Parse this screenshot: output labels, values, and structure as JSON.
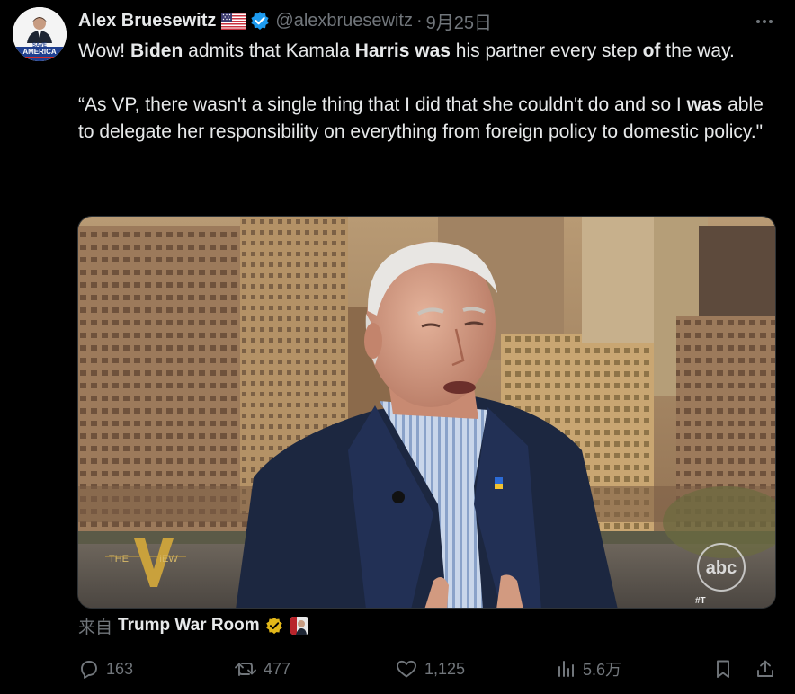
{
  "tweet": {
    "author_name": "Alex Bruesewitz",
    "handle": "@alexbruesewitz",
    "separator": "·",
    "time": "9月25日",
    "avatar_text_line1": "SAVE",
    "avatar_text_line2": "AMERICA",
    "para1": [
      {
        "text": "Wow! ",
        "bold": false
      },
      {
        "text": "Biden",
        "bold": true
      },
      {
        "text": " admits that Kamala ",
        "bold": false
      },
      {
        "text": "Harris was",
        "bold": true
      },
      {
        "text": " his partner every step ",
        "bold": false
      },
      {
        "text": "of",
        "bold": true
      },
      {
        "text": " the way.",
        "bold": false
      }
    ],
    "para2": [
      {
        "text": "“As VP, there wasn't a single thing that I did that she couldn't do and so I ",
        "bold": false
      },
      {
        "text": "was",
        "bold": true
      },
      {
        "text": " able to delegate her responsibility on everything from foreign policy to domestic policy.\"",
        "bold": false
      }
    ]
  },
  "media": {
    "show_logo_left": "THE",
    "show_logo_v": "V",
    "show_logo_right": "IEW",
    "network_logo": "abc",
    "corner_tag": "#T"
  },
  "source": {
    "from_label": "来自",
    "account": "Trump War Room"
  },
  "actions": {
    "replies": "163",
    "retweets": "477",
    "likes": "1,125",
    "views": "5.6万"
  },
  "colors": {
    "background": "#000000",
    "text_primary": "#e7e9ea",
    "text_secondary": "#71767b",
    "verified_blue": "#1d9bf0",
    "verified_gold": "#e2b719"
  }
}
